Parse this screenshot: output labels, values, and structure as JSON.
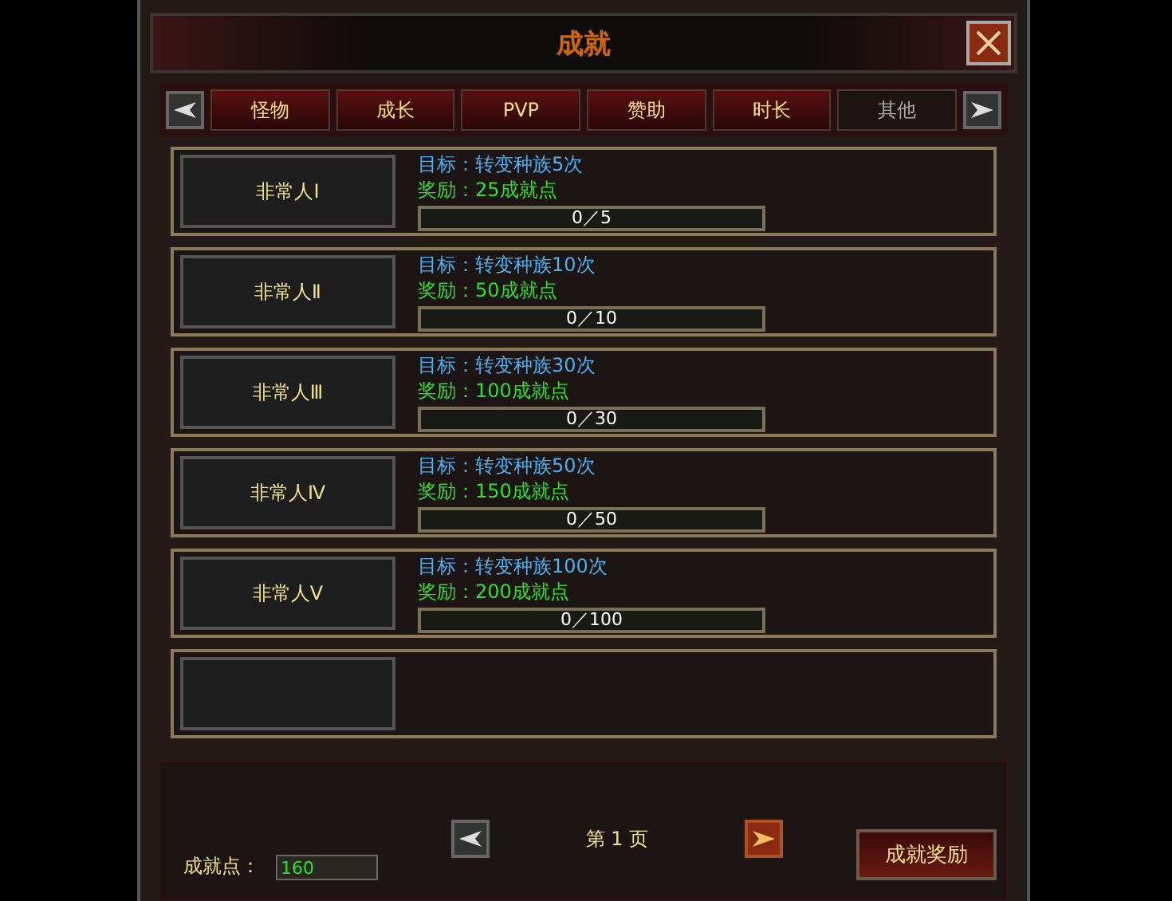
{
  "window": {
    "title": "成就"
  },
  "tabs": [
    {
      "label": "怪物",
      "selected": false
    },
    {
      "label": "成长",
      "selected": false
    },
    {
      "label": "PVP",
      "selected": false
    },
    {
      "label": "赞助",
      "selected": false
    },
    {
      "label": "时长",
      "selected": false
    },
    {
      "label": "其他",
      "selected": true
    }
  ],
  "achievements": [
    {
      "kind": "achievement",
      "name": "非常人Ⅰ",
      "goal": "目标：转变种族5次",
      "reward": "奖励：25成就点",
      "progress": "0／5"
    },
    {
      "kind": "achievement",
      "name": "非常人Ⅱ",
      "goal": "目标：转变种族10次",
      "reward": "奖励：50成就点",
      "progress": "0／10"
    },
    {
      "kind": "achievement",
      "name": "非常人Ⅲ",
      "goal": "目标：转变种族30次",
      "reward": "奖励：100成就点",
      "progress": "0／30"
    },
    {
      "kind": "achievement",
      "name": "非常人Ⅳ",
      "goal": "目标：转变种族50次",
      "reward": "奖励：150成就点",
      "progress": "0／50"
    },
    {
      "kind": "achievement",
      "name": "非常人Ⅴ",
      "goal": "目标：转变种族100次",
      "reward": "奖励：200成就点",
      "progress": "0／100"
    },
    {
      "kind": "empty"
    }
  ],
  "footer": {
    "points_label": "成就点：",
    "points_value": "160",
    "page": "第 1 页",
    "reward_button": "成就奖励"
  }
}
